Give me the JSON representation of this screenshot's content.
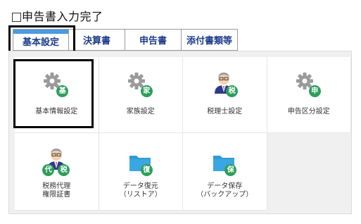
{
  "header": {
    "title": "申告書入力完了"
  },
  "tabs": [
    {
      "label": "基本設定"
    },
    {
      "label": "決算書"
    },
    {
      "label": "申告書"
    },
    {
      "label": "添付書類等"
    }
  ],
  "tiles": [
    {
      "label": "基本情報設定",
      "badge": "基",
      "icon": "gear-icon"
    },
    {
      "label": "家族設定",
      "badge": "家",
      "icon": "gear-icon"
    },
    {
      "label": "税理士設定",
      "badge": "税",
      "icon": "person-icon"
    },
    {
      "label": "申告区分設定",
      "badge": "申",
      "icon": "gear-icon"
    },
    {
      "label": "税務代理\n権限証書",
      "badge_left": "代",
      "badge": "税",
      "icon": "person-icon"
    },
    {
      "label": "データ復元\n（リストア）",
      "badge": "復",
      "icon": "folder-icon"
    },
    {
      "label": "データ保存\n（バックアップ）",
      "badge": "保",
      "icon": "folder-icon"
    }
  ],
  "colors": {
    "tab_text": "#1e3c8c",
    "tab_accent": "#4a9ae0",
    "badge": "#2e9e5b",
    "folder": "#2f9ad6"
  }
}
